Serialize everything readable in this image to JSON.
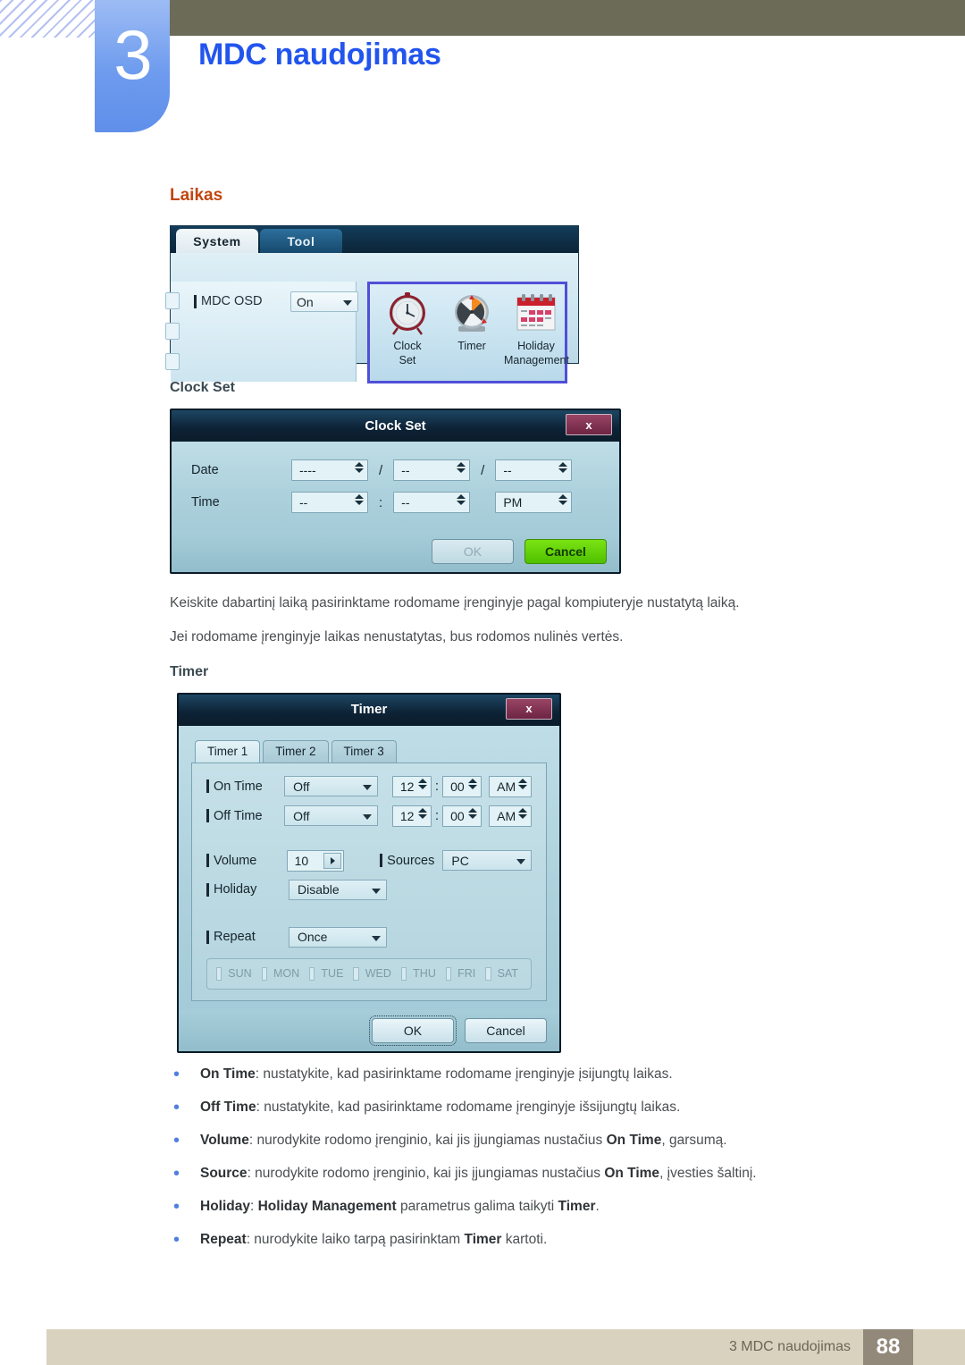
{
  "header": {
    "chapter_number": "3",
    "chapter_title": "MDC naudojimas",
    "olive_color": "#6c6b57",
    "accent_blue": "#2255ee"
  },
  "section": {
    "title": "Laikas",
    "title_color": "#c2450f"
  },
  "ribbon": {
    "tabs": [
      {
        "label": "System",
        "active": true
      },
      {
        "label": "Tool",
        "active": false
      }
    ],
    "osd": {
      "label": "MDC OSD",
      "value": "On",
      "caret_icon": "chevron-down-icon"
    },
    "group_items": [
      {
        "caption_line1": "Clock",
        "caption_line2": "Set",
        "icon": "clock-icon"
      },
      {
        "caption_line1": "Timer",
        "caption_line2": "",
        "icon": "timer-dial-icon"
      },
      {
        "caption_line1": "Holiday",
        "caption_line2": "Management",
        "icon": "calendar-icon"
      }
    ],
    "highlight_color": "#4f4fd8"
  },
  "clock_set": {
    "heading": "Clock Set",
    "dialog_title": "Clock Set",
    "close_label": "x",
    "rows": [
      {
        "label": "Date",
        "fields": [
          {
            "value": "----"
          },
          {
            "value": "--"
          },
          {
            "value": "--"
          }
        ],
        "separators": [
          "/",
          "/"
        ]
      },
      {
        "label": "Time",
        "fields": [
          {
            "value": "--"
          },
          {
            "value": "--"
          },
          {
            "value": "PM"
          }
        ],
        "separators": [
          ":",
          ""
        ]
      }
    ],
    "buttons": {
      "ok": "OK",
      "cancel": "Cancel"
    }
  },
  "paragraphs": [
    "Keiskite dabartinį laiką pasirinktame rodomame įrenginyje pagal kompiuteryje nustatytą laiką.",
    "Jei rodomame įrenginyje laikas nenustatytas, bus rodomos nulinės vertės."
  ],
  "timer": {
    "heading": "Timer",
    "dialog_title": "Timer",
    "close_label": "x",
    "tabs": [
      {
        "label": "Timer 1",
        "active": true
      },
      {
        "label": "Timer 2",
        "active": false
      },
      {
        "label": "Timer 3",
        "active": false
      }
    ],
    "on_time": {
      "label": "On Time",
      "state": "Off",
      "hour": "12",
      "minute": "00",
      "meridiem": "AM"
    },
    "off_time": {
      "label": "Off Time",
      "state": "Off",
      "hour": "12",
      "minute": "00",
      "meridiem": "AM"
    },
    "volume": {
      "label": "Volume",
      "value": "10"
    },
    "sources": {
      "label": "Sources",
      "value": "PC"
    },
    "holiday": {
      "label": "Holiday",
      "value": "Disable"
    },
    "repeat": {
      "label": "Repeat",
      "value": "Once"
    },
    "days": [
      "SUN",
      "MON",
      "TUE",
      "WED",
      "THU",
      "FRI",
      "SAT"
    ],
    "buttons": {
      "ok": "OK",
      "cancel": "Cancel"
    },
    "time_separator": ":"
  },
  "bullets": [
    {
      "term": "On Time",
      "rest": ": nustatykite, kad pasirinktame rodomame įrenginyje įsijungtų laikas."
    },
    {
      "term": "Off Time",
      "rest": ": nustatykite, kad pasirinktame rodomame įrenginyje išsijungtų laikas."
    },
    {
      "term": "Volume",
      "rest": ": nurodykite rodomo įrenginio, kai jis įjungiamas nustačius ",
      "term2": "On Time",
      "rest2": ", garsumą."
    },
    {
      "term": "Source",
      "rest": ": nurodykite rodomo įrenginio, kai jis įjungiamas nustačius ",
      "term2": "On Time",
      "rest2": ", įvesties šaltinį."
    },
    {
      "term": "Holiday",
      "rest": ": ",
      "term2": "Holiday Management",
      "rest2": " parametrus galima taikyti ",
      "term3": "Timer",
      "rest3": "."
    },
    {
      "term": "Repeat",
      "rest": ": nurodykite laiko tarpą pasirinktam ",
      "term2": "Timer",
      "rest2": " kartoti."
    }
  ],
  "footer": {
    "text": "3 MDC naudojimas",
    "page": "88"
  }
}
